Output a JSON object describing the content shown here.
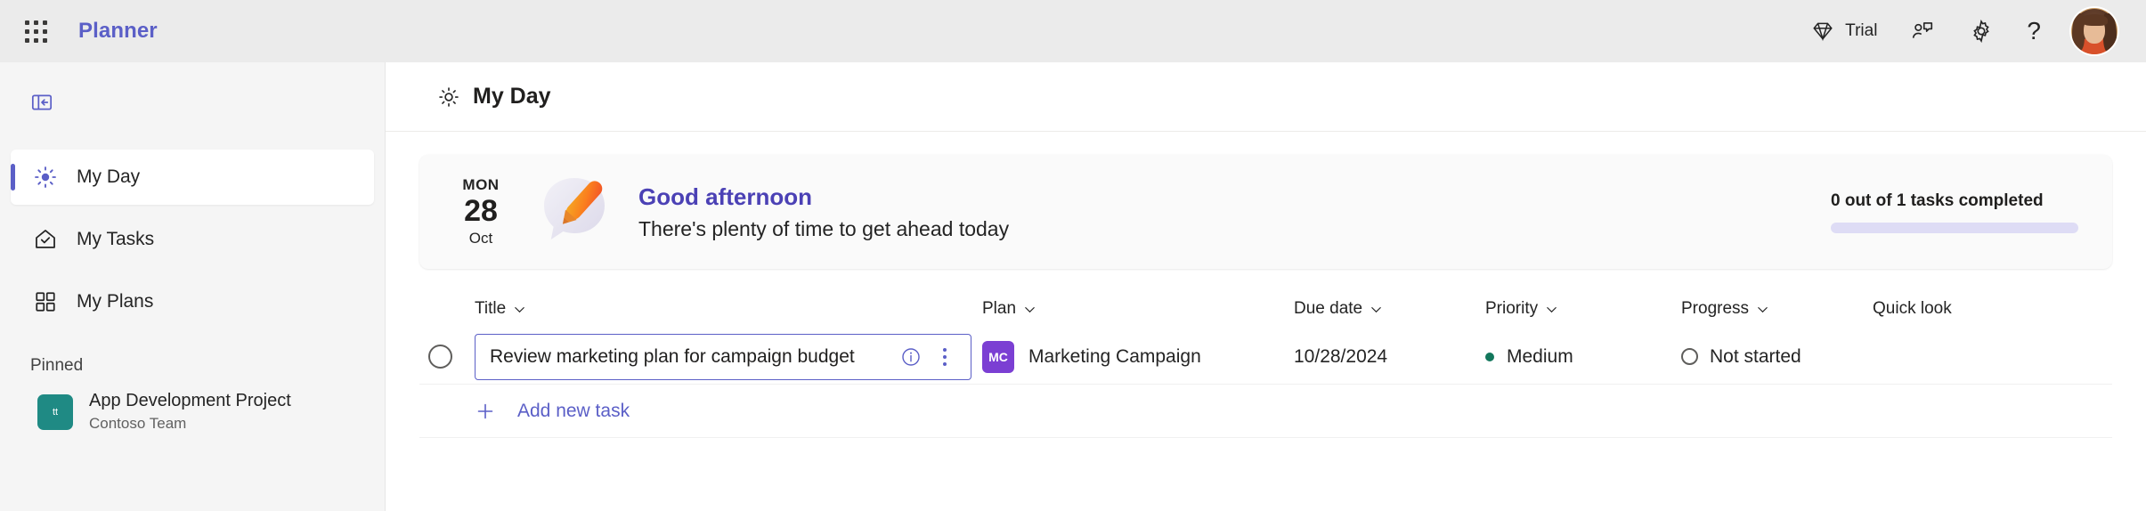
{
  "app": {
    "brand": "Planner",
    "waffle_icon": "app-launcher-grid-icon"
  },
  "topbar": {
    "trial": {
      "label": "Trial",
      "icon": "diamond-icon"
    },
    "feedback": {
      "icon": "person-feedback-icon"
    },
    "settings": {
      "icon": "gear-icon"
    },
    "help": {
      "icon": "question-mark-icon",
      "glyph": "?"
    },
    "avatar": {
      "icon": "user-avatar"
    }
  },
  "sidebar": {
    "collapse": {
      "icon": "collapse-panel-icon"
    },
    "items": [
      {
        "label": "My Day",
        "icon": "sun-icon",
        "active": true
      },
      {
        "label": "My Tasks",
        "icon": "checkmark-home-icon",
        "active": false
      },
      {
        "label": "My Plans",
        "icon": "grid-squares-icon",
        "active": false
      }
    ],
    "pinned_header": "Pinned",
    "pinned": [
      {
        "name": "App Development Project",
        "subtitle": "Contoso Team",
        "tile_text": "tt",
        "tile_color": "#1F8A84"
      }
    ]
  },
  "page": {
    "title": "My Day",
    "title_icon": "sun-icon"
  },
  "banner": {
    "date": {
      "dow": "MON",
      "day": "28",
      "month": "Oct"
    },
    "illustration": "speech-bubble-pencil-illustration",
    "greeting_title": "Good afternoon",
    "greeting_subtitle": "There's plenty of time to get ahead today",
    "progress_label": "0 out of 1 tasks completed",
    "progress_percent": 0,
    "progress_track_color": "#DEDCF5",
    "progress_fill_color": "#5B5FC7"
  },
  "table": {
    "columns": [
      {
        "key": "title",
        "label": "Title",
        "sortable": true
      },
      {
        "key": "plan",
        "label": "Plan",
        "sortable": true
      },
      {
        "key": "due",
        "label": "Due date",
        "sortable": true
      },
      {
        "key": "priority",
        "label": "Priority",
        "sortable": true
      },
      {
        "key": "progress",
        "label": "Progress",
        "sortable": true
      },
      {
        "key": "quick",
        "label": "Quick look",
        "sortable": false
      }
    ],
    "rows": [
      {
        "checkbox": "unchecked",
        "title": "Review marketing plan for campaign budget",
        "info_icon": "info-circle-icon",
        "more_icon": "more-options-kebab-icon",
        "plan_initials": "MC",
        "plan_color": "#7B3FD3",
        "plan": "Marketing Campaign",
        "due": "10/28/2024",
        "priority": "Medium",
        "priority_dot_color": "#13775C",
        "progress": "Not started"
      }
    ],
    "add_task_label": "Add new task",
    "add_task_icon": "plus-icon"
  },
  "theme": {
    "accent": "#5B5FC7",
    "greeting_purple": "#4B41B5",
    "topbar_bg": "#EBEBEB",
    "sidebar_bg": "#F5F5F5"
  }
}
